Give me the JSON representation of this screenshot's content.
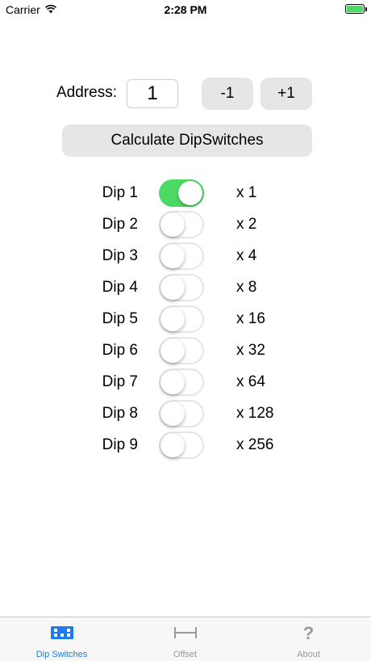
{
  "status_bar": {
    "carrier": "Carrier",
    "time": "2:28 PM"
  },
  "address": {
    "label": "Address:",
    "value": "1"
  },
  "buttons": {
    "decrement": "-1",
    "increment": "+1",
    "calculate": "Calculate DipSwitches"
  },
  "dips": [
    {
      "label": "Dip 1",
      "multiplier": "x 1",
      "on": true
    },
    {
      "label": "Dip 2",
      "multiplier": "x 2",
      "on": false
    },
    {
      "label": "Dip 3",
      "multiplier": "x 4",
      "on": false
    },
    {
      "label": "Dip 4",
      "multiplier": "x 8",
      "on": false
    },
    {
      "label": "Dip 5",
      "multiplier": "x 16",
      "on": false
    },
    {
      "label": "Dip 6",
      "multiplier": "x 32",
      "on": false
    },
    {
      "label": "Dip 7",
      "multiplier": "x 64",
      "on": false
    },
    {
      "label": "Dip 8",
      "multiplier": "x 128",
      "on": false
    },
    {
      "label": "Dip 9",
      "multiplier": "x 256",
      "on": false
    }
  ],
  "tab_bar": {
    "tabs": [
      {
        "label": "Dip Switches",
        "icon": "dip-switches-icon",
        "active": true
      },
      {
        "label": "Offset",
        "icon": "offset-icon",
        "active": false
      },
      {
        "label": "About",
        "icon": "question-mark-icon",
        "active": false
      }
    ]
  },
  "colors": {
    "toggle_on": "#4cd964",
    "tab_active": "#1a7cf0",
    "tab_inactive": "#9a9a9a",
    "button_bg": "#e6e6e6"
  }
}
